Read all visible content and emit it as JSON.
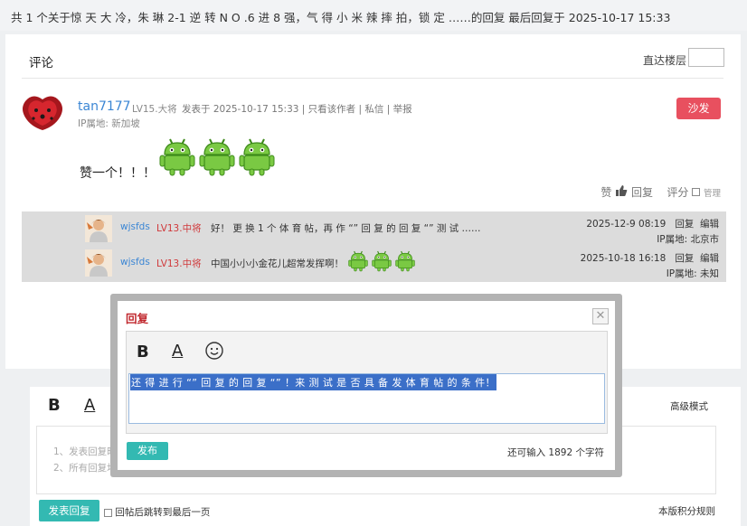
{
  "topbar": {
    "summary": "共 1 个关于惊 天 大 冷，朱 琳 2-1 逆 转 N O .6 进 8 强，气 得 小 米 辣 摔 拍，锁 定 ……的回复 最后回复于 2025-10-17 15:33"
  },
  "comments": {
    "title": "评论",
    "jump_label": "直达楼层",
    "jump_value": ""
  },
  "post": {
    "username": "tan7177",
    "level": "LV15.大将",
    "meta": "发表于 2025-10-17 15:33  |  只看该作者  |  私信  |  举报",
    "ip": "IP属地: 新加坡",
    "sofa_label": "沙发",
    "content": "赞一个！！！",
    "like_label": "赞",
    "reply_label": "回复",
    "rate_label": "评分",
    "manage_label": "管理"
  },
  "replies": [
    {
      "username": "wjsfds",
      "level": "LV13.中将",
      "text": "好！  更 换 1 个 体 育 帖，再 作  “”  回 复 的 回 复  “”  测  试 ……",
      "date": "2025-12-9 08:19",
      "reply_label": "回复",
      "edit_label": "编辑",
      "ip": "IP属地: 北京市"
    },
    {
      "username": "wjsfds",
      "level": "LV13.中将",
      "text": "中国小小小金花儿超常发挥啊！",
      "date": "2025-10-18 16:18",
      "reply_label": "回复",
      "edit_label": "编辑",
      "ip": "IP属地: 未知"
    }
  ],
  "bottom_editor": {
    "bold": "B",
    "underline": "A",
    "advanced": "高级模式",
    "tip1": "1、发表回复时",
    "tip2": "2、所有回复均",
    "post_button": "发表回复",
    "jump_last": "回帖后跳转到最后一页",
    "rules": "本版积分规则"
  },
  "reply_modal": {
    "title": "回复",
    "close": "✕",
    "bold": "B",
    "underline": "A",
    "text": "还 得 进 行 “” 回 复 的 回 复 “” ！来 测 试 是 否 具 备 发 体 育 帖 的 条 件！",
    "post_button": "发布",
    "remaining": "还可输入 1892 个字符"
  },
  "colors": {
    "accent_red": "#e8505f",
    "teal": "#33b9b2",
    "link_blue": "#3b86d4",
    "selection_blue": "#3b6fc8"
  }
}
